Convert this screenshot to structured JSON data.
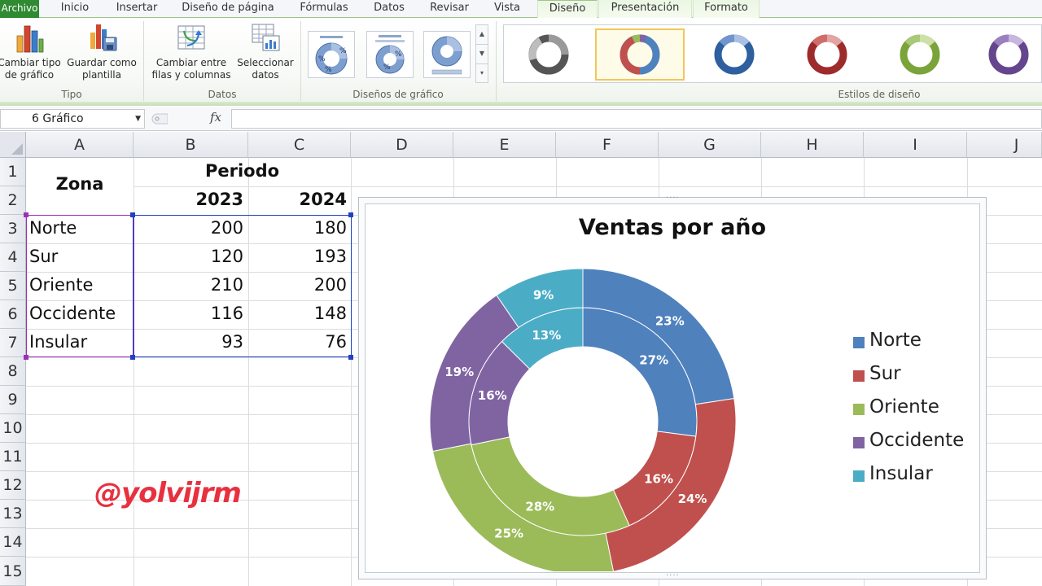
{
  "tabs": [
    "Archivo",
    "Inicio",
    "Insertar",
    "Diseño de página",
    "Fórmulas",
    "Datos",
    "Revisar",
    "Vista",
    "Diseño",
    "Presentación",
    "Formato"
  ],
  "ribbon": {
    "tipo": {
      "label": "Tipo",
      "btn1": [
        "Cambiar tipo",
        "de gráfico"
      ],
      "btn2": [
        "Guardar como",
        "plantilla"
      ]
    },
    "datos": {
      "label": "Datos",
      "btn1": [
        "Cambiar entre",
        "filas y columnas"
      ],
      "btn2": [
        "Seleccionar",
        "datos"
      ]
    },
    "disenos": {
      "label": "Diseños de gráfico",
      "layout_pct": "%"
    },
    "estilos": {
      "label": "Estilos de diseño"
    },
    "scroll": [
      "▲",
      "▼",
      "▾"
    ]
  },
  "formula_bar": {
    "name_box": "6 Gráfico",
    "fx": "fx",
    "value": ""
  },
  "columns": [
    "A",
    "B",
    "C",
    "D",
    "E",
    "F",
    "G",
    "H",
    "I",
    "J"
  ],
  "rows": [
    "1",
    "2",
    "3",
    "4",
    "5",
    "6",
    "7",
    "8",
    "9",
    "10",
    "11",
    "12",
    "13",
    "14",
    "15"
  ],
  "sheet": {
    "zona_header": "Zona",
    "periodo_header": "Periodo",
    "year1": "2023",
    "year2": "2024",
    "zones": [
      "Norte",
      "Sur",
      "Oriente",
      "Occidente",
      "Insular"
    ],
    "values_2023": [
      "200",
      "120",
      "210",
      "116",
      "93"
    ],
    "values_2024": [
      "180",
      "193",
      "200",
      "148",
      "76"
    ]
  },
  "watermark": "@yolvijrm",
  "chart_data": {
    "type": "doughnut",
    "title": "Ventas por año",
    "categories": [
      "Norte",
      "Sur",
      "Oriente",
      "Occidente",
      "Insular"
    ],
    "colors": [
      "#4f81bd",
      "#c0504d",
      "#9bbb59",
      "#8064a2",
      "#4bacc6"
    ],
    "series": [
      {
        "name": "2023",
        "values": [
          200,
          120,
          210,
          116,
          93
        ],
        "labels": [
          "27%",
          "16%",
          "28%",
          "16%",
          "13%"
        ]
      },
      {
        "name": "2024",
        "values": [
          180,
          193,
          200,
          148,
          76
        ],
        "labels": [
          "23%",
          "24%",
          "25%",
          "19%",
          "9%"
        ]
      }
    ],
    "legend_position": "right"
  }
}
